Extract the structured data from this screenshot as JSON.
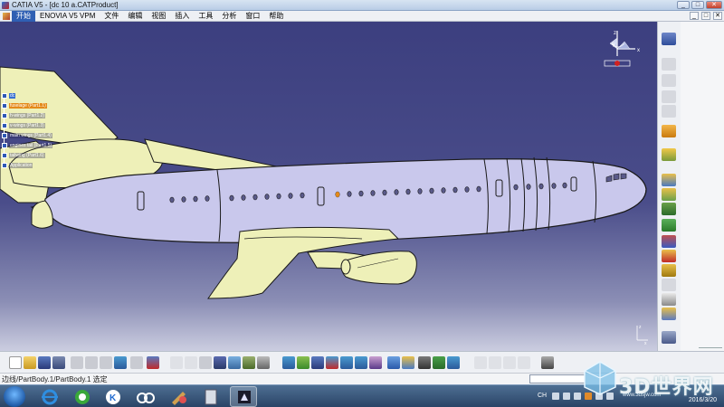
{
  "window": {
    "title": "CATIA V5 - [dc 10 a.CATProduct]",
    "controls": [
      "_",
      "□",
      "✕"
    ]
  },
  "menubar": {
    "items": [
      "开始",
      "ENOVIA V5 VPM",
      "文件",
      "编辑",
      "视图",
      "插入",
      "工具",
      "分析",
      "窗口",
      "帮助"
    ],
    "active_index": 0,
    "doc_controls": [
      "_",
      "□",
      "✕"
    ]
  },
  "spec_tree": {
    "root": "dc",
    "items": [
      {
        "label": "fuselage (Part1.1)",
        "selected": true
      },
      {
        "label": "h-wings (Part1.2)",
        "selected": false
      },
      {
        "label": "v-wings (Part1.3)",
        "selected": false
      },
      {
        "label": "main wings (Part1.4)",
        "selected": false
      },
      {
        "label": "engines tail (Part1.5)",
        "selected": false
      },
      {
        "label": "tailwing (Part1.6)",
        "selected": false
      },
      {
        "label": "Application",
        "selected": false
      }
    ]
  },
  "compass": {
    "labels": [
      "z",
      "y",
      "x"
    ]
  },
  "triad": {
    "labels": [
      "z",
      "x"
    ]
  },
  "colors": {
    "fuselage": "#c9c8ec",
    "wings": "#eef0b8",
    "outline": "#1a1a1a",
    "window": "#5a5a8a",
    "selection": "#e48a1a",
    "viewport_top": "#3c3f7f"
  },
  "status": {
    "text": "边线/PartBody.1/PartBody.1 选定"
  },
  "taskbar": {
    "lang": "CH",
    "date": "2016/3/20"
  },
  "watermark": {
    "text": "3D世界网",
    "url": "www.3dsjw.com"
  }
}
